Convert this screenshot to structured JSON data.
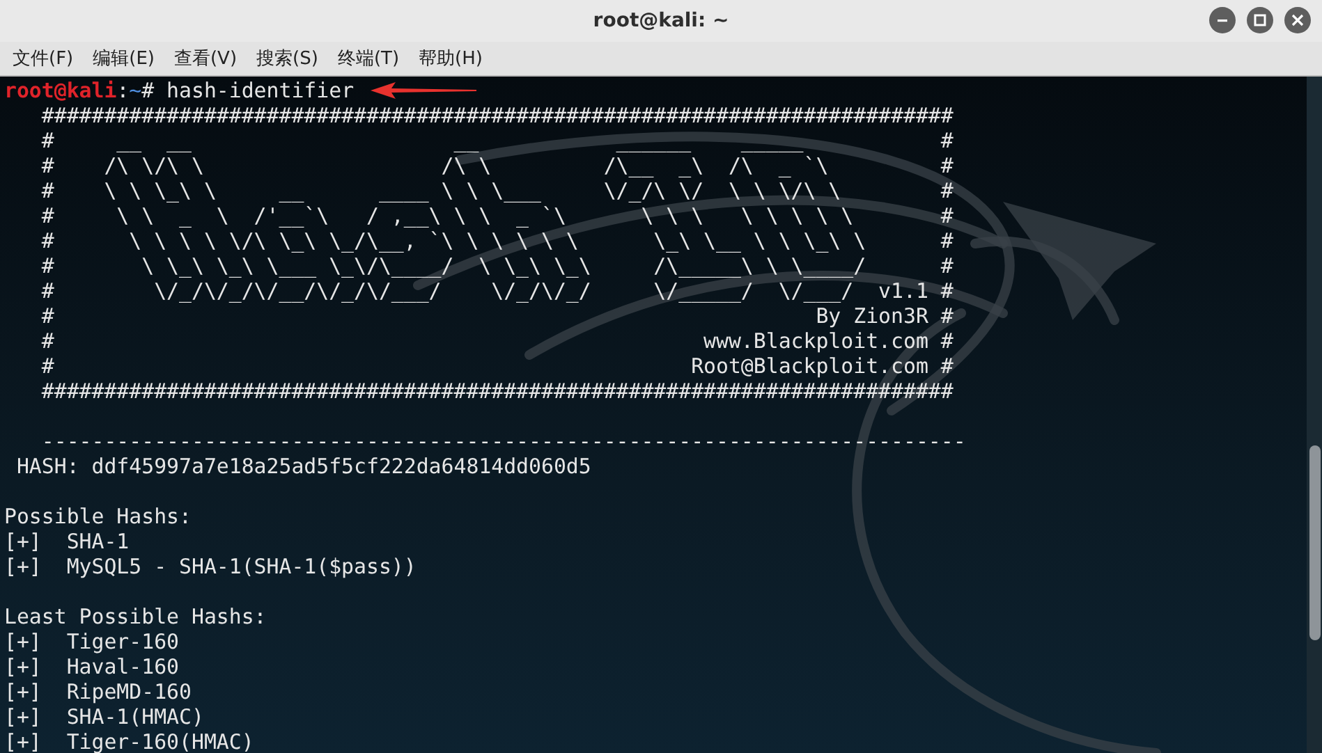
{
  "window": {
    "title": "root@kali: ~"
  },
  "menu": [
    "文件(F)",
    "编辑(E)",
    "查看(V)",
    "搜索(S)",
    "终端(T)",
    "帮助(H)"
  ],
  "terminal": {
    "lines": [
      {
        "kind": "prompt",
        "user_host": "root@kali",
        "separator": ":",
        "path": "~",
        "symbol": "#",
        "command": "hash-identifier"
      },
      {
        "kind": "text",
        "text": "   #########################################################################"
      },
      {
        "kind": "text",
        "text": "   #     __  __                     __           ______    _____           #"
      },
      {
        "kind": "text",
        "text": "   #    /\\ \\/\\ \\                   /\\ \\         /\\__  _\\  /\\  _ `\\         #"
      },
      {
        "kind": "text",
        "text": "   #    \\ \\ \\_\\ \\     __      ____ \\ \\ \\___     \\/_/\\ \\/  \\ \\ \\/\\ \\        #"
      },
      {
        "kind": "text",
        "text": "   #     \\ \\  _  \\  /'__`\\   / ,__\\ \\ \\  _ `\\      \\ \\ \\   \\ \\ \\ \\ \\       #"
      },
      {
        "kind": "text",
        "text": "   #      \\ \\ \\ \\ \\/\\ \\_\\ \\_/\\__, `\\ \\ \\ \\ \\ \\      \\_\\ \\__ \\ \\ \\_\\ \\      #"
      },
      {
        "kind": "text",
        "text": "   #       \\ \\_\\ \\_\\ \\___ \\_\\/\\____/  \\ \\_\\ \\_\\     /\\_____\\ \\ \\____/      #"
      },
      {
        "kind": "text",
        "text": "   #        \\/_/\\/_/\\/__/\\/_/\\/___/    \\/_/\\/_/     \\/_____/  \\/___/  v1.1 #"
      },
      {
        "kind": "text",
        "text": "   #                                                             By Zion3R #"
      },
      {
        "kind": "text",
        "text": "   #                                                    www.Blackploit.com #"
      },
      {
        "kind": "text",
        "text": "   #                                                   Root@Blackploit.com #"
      },
      {
        "kind": "text",
        "text": "   #########################################################################"
      },
      {
        "kind": "blank"
      },
      {
        "kind": "text",
        "text": "   --------------------------------------------------------------------------"
      },
      {
        "kind": "text",
        "text": " HASH: ddf45997a7e18a25ad5f5cf222da64814dd060d5"
      },
      {
        "kind": "blank"
      },
      {
        "kind": "text",
        "text": "Possible Hashs:"
      },
      {
        "kind": "text",
        "text": "[+]  SHA-1"
      },
      {
        "kind": "text",
        "text": "[+]  MySQL5 - SHA-1(SHA-1($pass))"
      },
      {
        "kind": "blank"
      },
      {
        "kind": "text",
        "text": "Least Possible Hashs:"
      },
      {
        "kind": "text",
        "text": "[+]  Tiger-160"
      },
      {
        "kind": "text",
        "text": "[+]  Haval-160"
      },
      {
        "kind": "text",
        "text": "[+]  RipeMD-160"
      },
      {
        "kind": "text",
        "text": "[+]  SHA-1(HMAC)"
      },
      {
        "kind": "text",
        "text": "[+]  Tiger-160(HMAC)"
      }
    ]
  }
}
